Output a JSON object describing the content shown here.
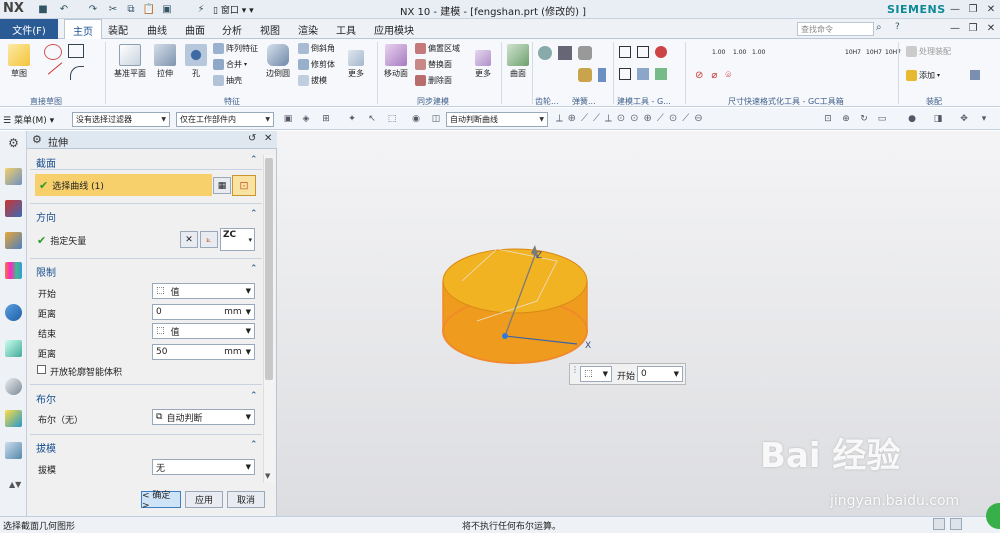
{
  "app": {
    "logo": "NX",
    "title": "NX 10 - 建模 - [fengshan.prt  (修改的) ]",
    "brand": "SIEMENS",
    "window_menu": "窗口"
  },
  "menu_tabs": {
    "file": "文件(F)",
    "tabs": [
      "主页",
      "装配",
      "曲线",
      "曲面",
      "分析",
      "视图",
      "渲染",
      "工具",
      "应用模块"
    ]
  },
  "search": {
    "placeholder": "查找命令"
  },
  "ribbon": {
    "sketch": "草图",
    "datum_plane": "基准平面",
    "extrude": "拉伸",
    "hole": "孔",
    "pattern_feature": "阵列特征",
    "unite": "合并",
    "shell": "抽壳",
    "edge_blend": "边倒圆",
    "chamfer": "倒斜角",
    "trim_body": "修剪体",
    "draft": "拔模",
    "more": "更多",
    "move_face": "移动面",
    "offset_region": "偏置区域",
    "replace_face": "替换面",
    "delete_face": "删除面",
    "surface": "曲面",
    "add": "添加",
    "assembly_constraints": "处理装配",
    "pmi_codes": [
      "1.00",
      "1.00",
      "1.00",
      "10H7",
      "10H7",
      "10H7"
    ],
    "groups": {
      "direct_sketch": "直接草图",
      "feature": "特征",
      "sync_modeling": "同步建模",
      "gear": "齿轮...",
      "spring": "弹簧...",
      "gc_modeling": "建模工具 - G...",
      "gc_dim": "尺寸快速格式化工具 - GC工具箱",
      "assembly": "装配"
    }
  },
  "toolbar2": {
    "menu": "菜单(M)",
    "filter": "没有选择过滤器",
    "scope": "仅在工作部件内",
    "curve_rule": "自动判断曲线"
  },
  "dialog": {
    "title": "拉伸",
    "section": {
      "label": "截面",
      "select_curve": "选择曲线 (1)"
    },
    "direction": {
      "label": "方向",
      "specify_vector": "指定矢量",
      "vector_value": "ZC"
    },
    "limits": {
      "label": "限制",
      "start_label": "开始",
      "start_value": "值",
      "start_distance_label": "距离",
      "start_distance": "0",
      "end_label": "结束",
      "end_value": "值",
      "end_distance_label": "距离",
      "end_distance": "50",
      "unit": "mm",
      "open_profile": "开放轮廓智能体积"
    },
    "boolean": {
      "label": "布尔",
      "field_label": "布尔（无）",
      "value": "自动判断"
    },
    "draft": {
      "label": "拔模",
      "field_label": "拔模",
      "value": "无"
    },
    "buttons": {
      "ok": "< 确定 >",
      "apply": "应用",
      "cancel": "取消"
    }
  },
  "viewport": {
    "axes": {
      "z": "Z",
      "x": "X"
    },
    "popup": {
      "label": "开始",
      "value": "0"
    }
  },
  "status": {
    "left": "选择截面几何图形",
    "center": "将不执行任何布尔运算。"
  },
  "watermark": {
    "text": "Bai 经验",
    "url": "jingyan.baidu.com"
  },
  "colors": {
    "accent": "#2b5b94",
    "selection_row": "#f7d06b",
    "body": "#f2b322",
    "edge": "#f08a2a",
    "section_text": "#1a4f8f"
  }
}
